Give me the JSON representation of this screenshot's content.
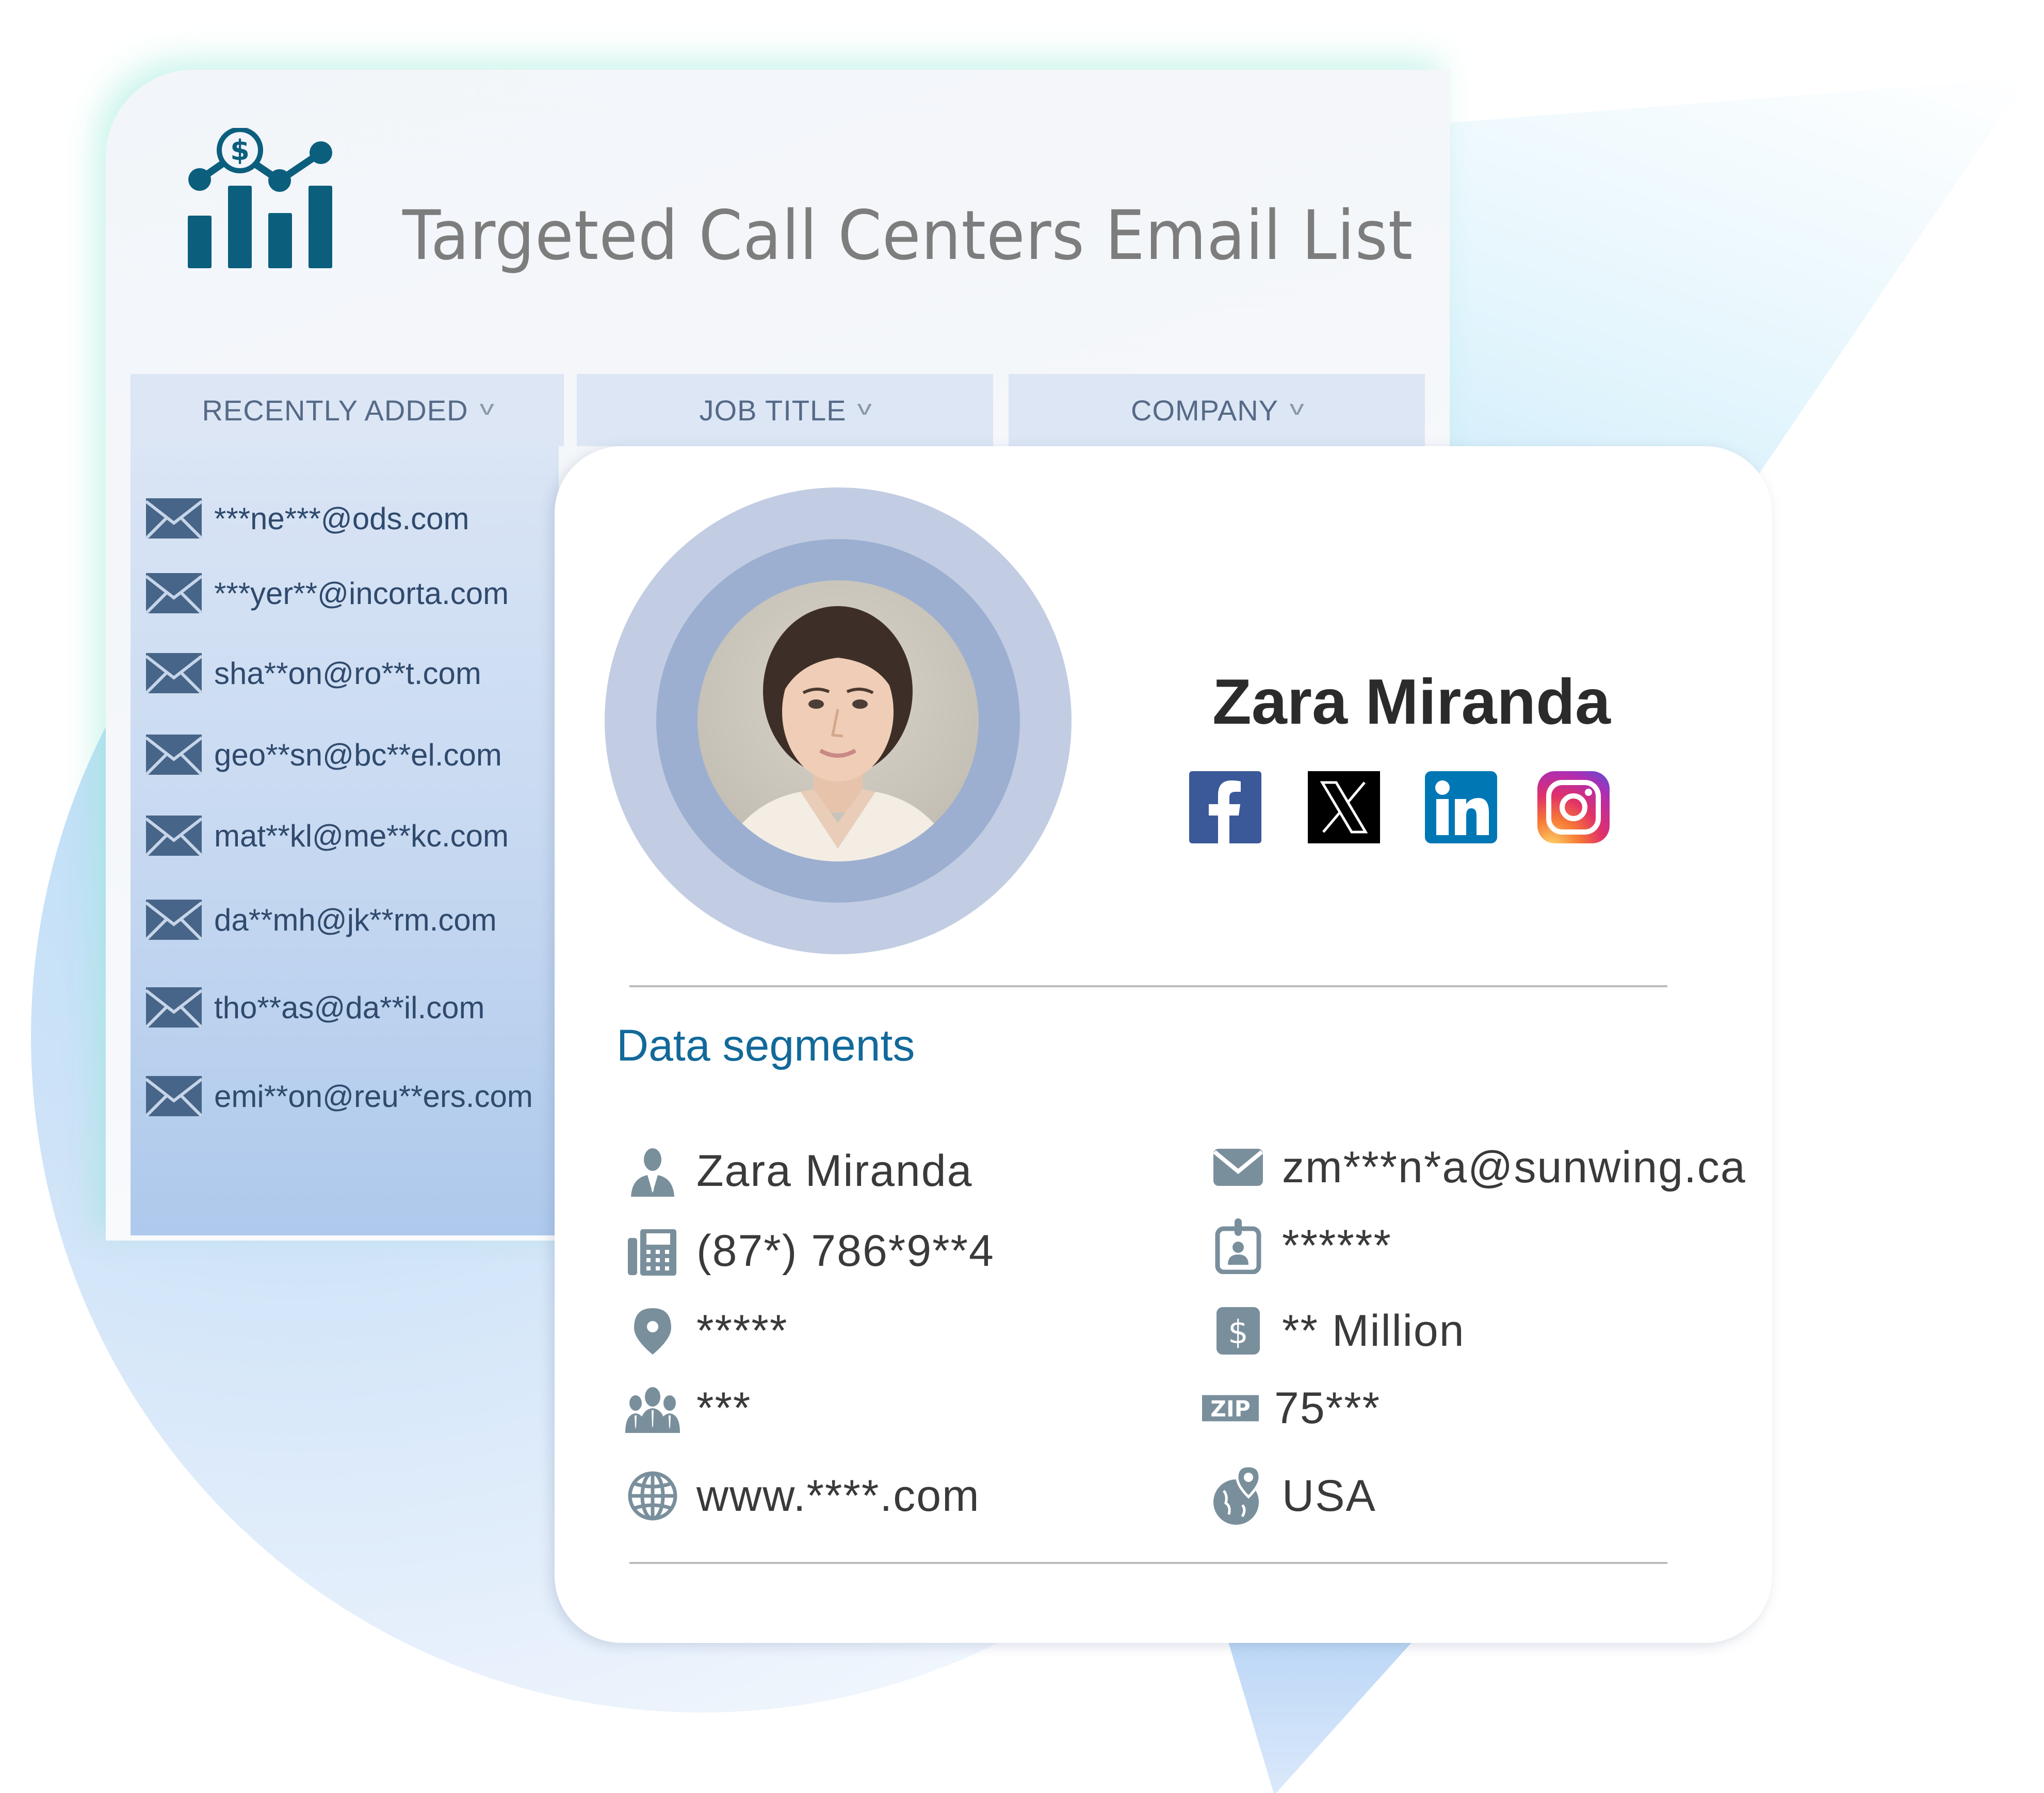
{
  "header": {
    "title": "Targeted Call Centers Email List",
    "logo_icon": "chart-dollar-icon"
  },
  "tabs": [
    {
      "label": "RECENTLY ADDED",
      "icon": "chevron-down-icon"
    },
    {
      "label": "JOB TITLE",
      "icon": "chevron-down-icon"
    },
    {
      "label": "COMPANY",
      "icon": "chevron-down-icon"
    }
  ],
  "email_list": [
    "***ne***@ods.com",
    "***yer**@incorta.com",
    "sha**on@ro**t.com",
    "geo**sn@bc**el.com",
    "mat**kl@me**kc.com",
    "da**mh@jk**rm.com",
    "tho**as@da**il.com",
    "emi**on@reu**ers.com"
  ],
  "profile": {
    "name": "Zara Miranda",
    "avatar_icon": "profile-photo",
    "social": [
      {
        "name": "Facebook",
        "icon": "facebook-icon",
        "color": "#3b5998"
      },
      {
        "name": "X",
        "icon": "x-icon",
        "color": "#000000"
      },
      {
        "name": "LinkedIn",
        "icon": "linkedin-icon",
        "color": "#0077b5"
      },
      {
        "name": "Instagram",
        "icon": "instagram-icon",
        "color": "#d6249f"
      }
    ]
  },
  "segments": {
    "title": "Data segments",
    "left": [
      {
        "icon": "person-icon",
        "value": "Zara Miranda"
      },
      {
        "icon": "office-phone-icon",
        "value": "(87*) 786*9**4"
      },
      {
        "icon": "location-pin-icon",
        "value": "*****"
      },
      {
        "icon": "employees-icon",
        "value": "***"
      },
      {
        "icon": "globe-icon",
        "value": "www.****.com"
      }
    ],
    "right": [
      {
        "icon": "email-icon",
        "value": "zm***n*a@sunwing.ca"
      },
      {
        "icon": "id-badge-icon",
        "value": "******"
      },
      {
        "icon": "dollar-icon",
        "value": "** Million"
      },
      {
        "icon": "zip-icon",
        "value": "75***",
        "badge_text": "ZIP"
      },
      {
        "icon": "globe-pin-icon",
        "value": "USA"
      }
    ]
  },
  "colors": {
    "brand_teal": "#0b5f7d",
    "segments_title": "#12699a",
    "icon_gray": "#7a8f9c",
    "tab_bg": "#dce6f5",
    "envelope": "#476588"
  }
}
